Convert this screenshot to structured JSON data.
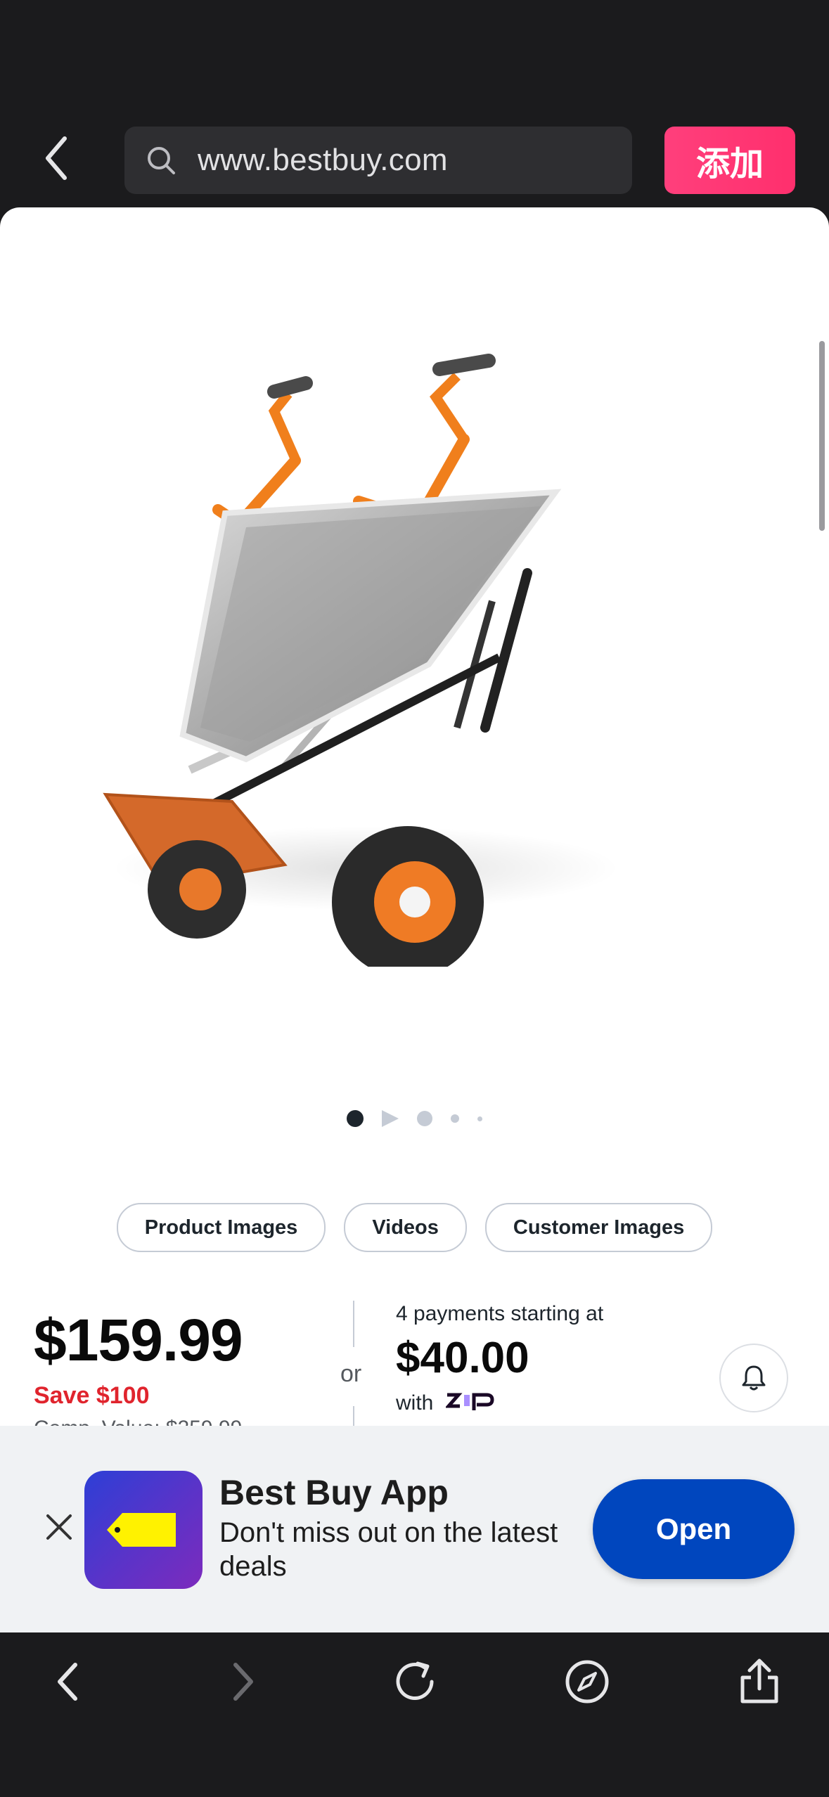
{
  "browser": {
    "url": "www.bestbuy.com",
    "add_button_label": "添加"
  },
  "gallery": {
    "dot_count": 5,
    "active_index": 0,
    "tabs": [
      {
        "label": "Product Images"
      },
      {
        "label": "Videos"
      },
      {
        "label": "Customer Images"
      }
    ]
  },
  "pricing": {
    "price": "$159.99",
    "save": "Save $100",
    "compare_value": "Comp. Value: $259.99",
    "or": "or",
    "payments_label": "4 payments starting at",
    "payment_amount": "$40.00",
    "with_label": "with",
    "zip_logo": "zip"
  },
  "app_banner": {
    "title": "Best Buy App",
    "subtitle": "Don't miss out on the latest deals",
    "open_label": "Open"
  },
  "icons": {
    "back": "chevron-left-icon",
    "search": "search-icon",
    "bell": "bell-icon",
    "close": "close-icon",
    "toolbar": [
      "back-arrow-icon",
      "forward-arrow-icon",
      "reload-icon",
      "compass-icon",
      "share-icon"
    ]
  },
  "colors": {
    "accent_add": "#ff2f6d",
    "save_red": "#e0242d",
    "open_blue": "#0046be",
    "tag_yellow": "#fff200"
  }
}
